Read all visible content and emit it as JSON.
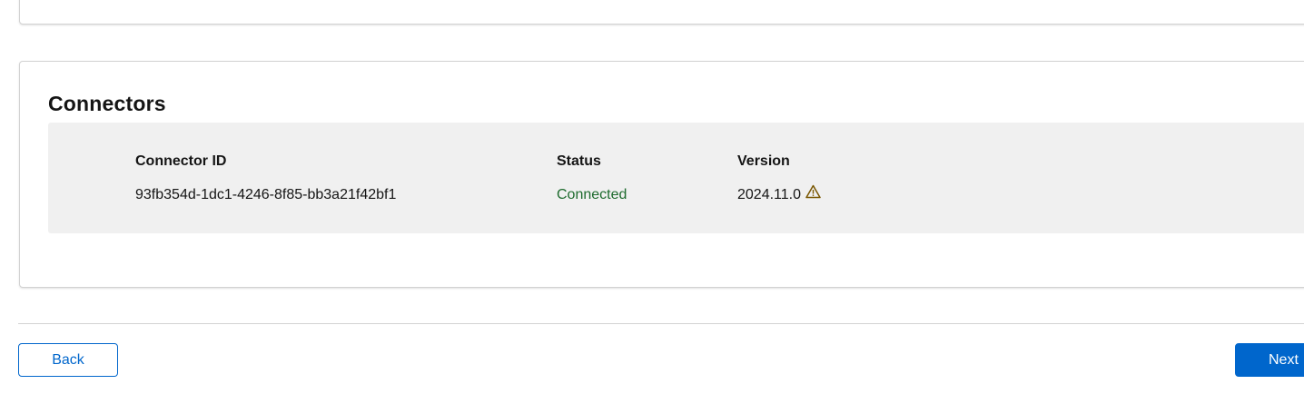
{
  "connectors": {
    "title": "Connectors",
    "columns": [
      "Connector ID",
      "Status",
      "Version"
    ],
    "rows": [
      {
        "id": "93fb354d-1dc1-4246-8f85-bb3a21f42bf1",
        "status": "Connected",
        "version": "2024.11.0",
        "version_icon": "warning-icon"
      }
    ]
  },
  "footer": {
    "back_label": "Back",
    "next_label": "Next"
  },
  "colors": {
    "accent": "#0066cc",
    "status_connected": "#1e6b2e",
    "warning": "#795600",
    "panel_bg": "#f0f0f0"
  }
}
